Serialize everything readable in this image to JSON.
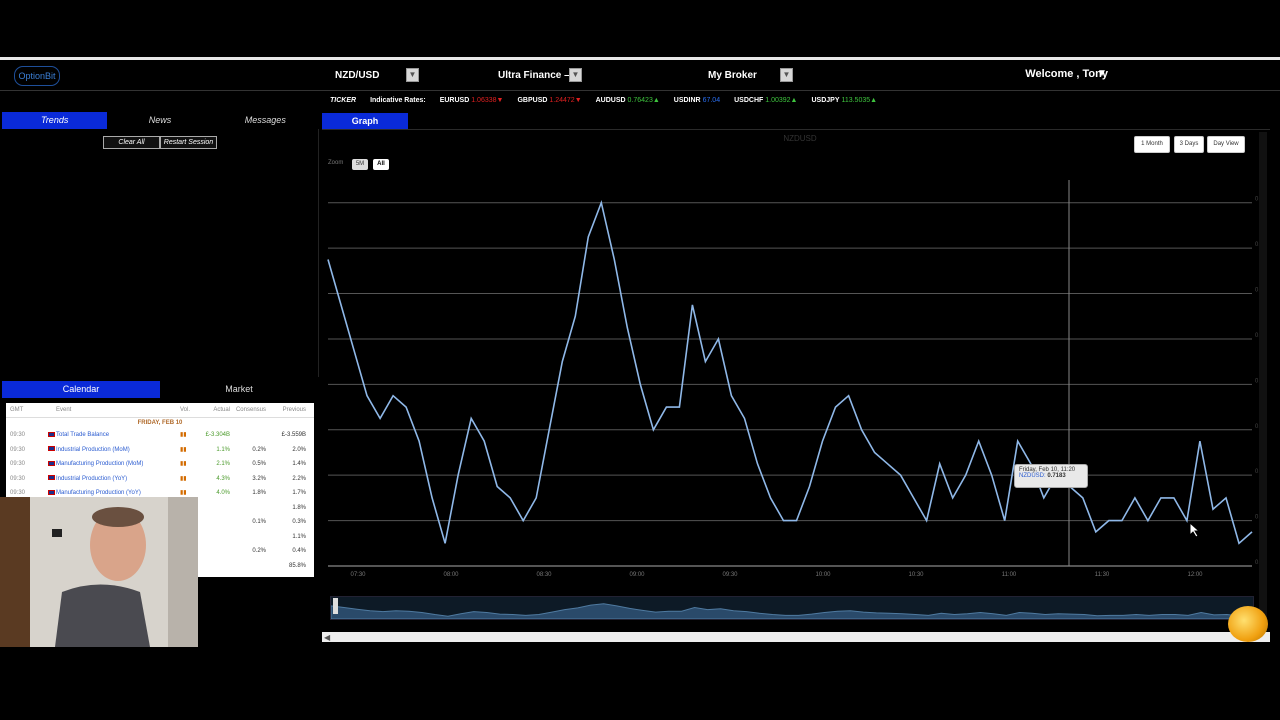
{
  "header": {
    "logo_text": "OptionBit",
    "symbol_select": "NZD/USD",
    "option_select": "Ultra Finance – U",
    "broker_select": "My Broker",
    "welcome": "Welcome , Tony",
    "welcome_arrow": "▼"
  },
  "ticker": {
    "label": "TICKER",
    "rates_label": "Indicative Rates:",
    "items": [
      {
        "pair": "EURUSD",
        "value": "1.06338",
        "dir": "▼"
      },
      {
        "pair": "GBPUSD",
        "value": "1.24472",
        "dir": "▼"
      },
      {
        "pair": "AUDUSD",
        "value": "0.76423",
        "dir": "▲"
      },
      {
        "pair": "USDINR",
        "value": "67.04",
        "dir": ""
      },
      {
        "pair": "USDCHF",
        "value": "1.00392",
        "dir": "▲"
      },
      {
        "pair": "USDJPY",
        "value": "113.5035",
        "dir": "▲"
      }
    ]
  },
  "left_tabs": [
    "Trends",
    "News",
    "Messages"
  ],
  "left_buttons": {
    "clear": "Clear All",
    "restart": "Restart Session"
  },
  "calendar": {
    "tabs": [
      "Calendar",
      "Market"
    ],
    "headers": [
      "GMT",
      "Event",
      "Vol.",
      "Actual",
      "Consensus",
      "Previous"
    ],
    "day": "FRIDAY, FEB 10",
    "rows": [
      {
        "gmt": "09:30",
        "event": "Total Trade Balance",
        "actual": "£-3.304B",
        "consensus": "",
        "previous": "£-3.559B"
      },
      {
        "gmt": "09:30",
        "event": "Industrial Production (MoM)",
        "actual": "1.1%",
        "consensus": "0.2%",
        "previous": "2.0%"
      },
      {
        "gmt": "09:30",
        "event": "Manufacturing Production (MoM)",
        "actual": "2.1%",
        "consensus": "0.5%",
        "previous": "1.4%"
      },
      {
        "gmt": "09:30",
        "event": "Industrial Production (YoY)",
        "actual": "4.3%",
        "consensus": "3.2%",
        "previous": "2.2%"
      },
      {
        "gmt": "09:30",
        "event": "Manufacturing Production (YoY)",
        "actual": "4.0%",
        "consensus": "1.8%",
        "previous": "1.7%"
      },
      {
        "gmt": "",
        "event": "",
        "actual": "",
        "consensus": "",
        "previous": "1.8%"
      },
      {
        "gmt": "",
        "event": "",
        "actual": "",
        "consensus": "0.1%",
        "previous": "0.3%"
      },
      {
        "gmt": "",
        "event": "",
        "actual": "",
        "consensus": "",
        "previous": "1.1%"
      },
      {
        "gmt": "",
        "event": "",
        "actual": "",
        "consensus": "0.2%",
        "previous": "0.4%"
      },
      {
        "gmt": "",
        "event": "",
        "actual": "",
        "consensus": "",
        "previous": "85.8%"
      }
    ]
  },
  "graph": {
    "tab": "Graph",
    "zoom_label": "Zoom",
    "zoom_buttons": [
      "5M",
      "All"
    ],
    "range_buttons": [
      "1 Month",
      "3 Days",
      "Day View"
    ],
    "title": "NZDUSD",
    "tooltip_date": "Friday, Feb 10, 11:20",
    "tooltip_series": "NZDUSD:",
    "tooltip_value": "0.7183"
  },
  "chart_data": {
    "type": "line",
    "title": "NZDUSD",
    "x": [
      "07:30",
      "07:34",
      "07:38",
      "07:42",
      "07:46",
      "07:50",
      "07:54",
      "07:58",
      "08:02",
      "08:06",
      "08:10",
      "08:14",
      "08:18",
      "08:22",
      "08:26",
      "08:30",
      "08:34",
      "08:38",
      "08:42",
      "08:46",
      "08:50",
      "08:54",
      "08:58",
      "09:02",
      "09:06",
      "09:10",
      "09:14",
      "09:18",
      "09:22",
      "09:26",
      "09:30",
      "09:34",
      "09:38",
      "09:42",
      "09:46",
      "09:50",
      "09:54",
      "09:58",
      "10:02",
      "10:06",
      "10:10",
      "10:14",
      "10:18",
      "10:22",
      "10:26",
      "10:30",
      "10:34",
      "10:38",
      "10:42",
      "10:46",
      "10:50",
      "10:54",
      "10:58",
      "11:02",
      "11:06",
      "11:10",
      "11:14",
      "11:18",
      "11:22",
      "11:26",
      "11:30",
      "11:34",
      "11:38",
      "11:42",
      "11:46",
      "11:50",
      "11:54",
      "11:58",
      "12:02",
      "12:06",
      "12:10",
      "12:14"
    ],
    "series": [
      {
        "values": [
          0.71935,
          0.71915,
          0.71895,
          0.71875,
          0.71865,
          0.71875,
          0.7187,
          0.71855,
          0.7183,
          0.7181,
          0.7184,
          0.71865,
          0.71855,
          0.71835,
          0.7183,
          0.7182,
          0.7183,
          0.7186,
          0.7189,
          0.7191,
          0.71945,
          0.7196,
          0.71935,
          0.71905,
          0.7188,
          0.7186,
          0.7187,
          0.7187,
          0.71915,
          0.7189,
          0.719,
          0.71875,
          0.71865,
          0.71845,
          0.7183,
          0.7182,
          0.7182,
          0.71835,
          0.71855,
          0.7187,
          0.71875,
          0.7186,
          0.7185,
          0.71845,
          0.7184,
          0.7183,
          0.7182,
          0.71845,
          0.7183,
          0.7184,
          0.71855,
          0.7184,
          0.7182,
          0.71855,
          0.71845,
          0.7183,
          0.7184,
          0.71835,
          0.7183,
          0.71815,
          0.7182,
          0.7182,
          0.7183,
          0.7182,
          0.7183,
          0.7183,
          0.7182,
          0.71855,
          0.71825,
          0.7183,
          0.7181,
          0.71815
        ]
      }
    ],
    "x_ticks": [
      "07:30",
      "08:00",
      "08:30",
      "09:00",
      "09:30",
      "10:00",
      "10:30",
      "11:00",
      "11:30",
      "12:00"
    ],
    "y_ticks": [
      "0.7196",
      "0.7194",
      "0.7192",
      "0.719",
      "0.7188",
      "0.7186",
      "0.7184",
      "0.7182",
      "0.718"
    ],
    "ylim": [
      0.718,
      0.7197
    ],
    "grid": true,
    "line_color": "#8fb8e8"
  }
}
